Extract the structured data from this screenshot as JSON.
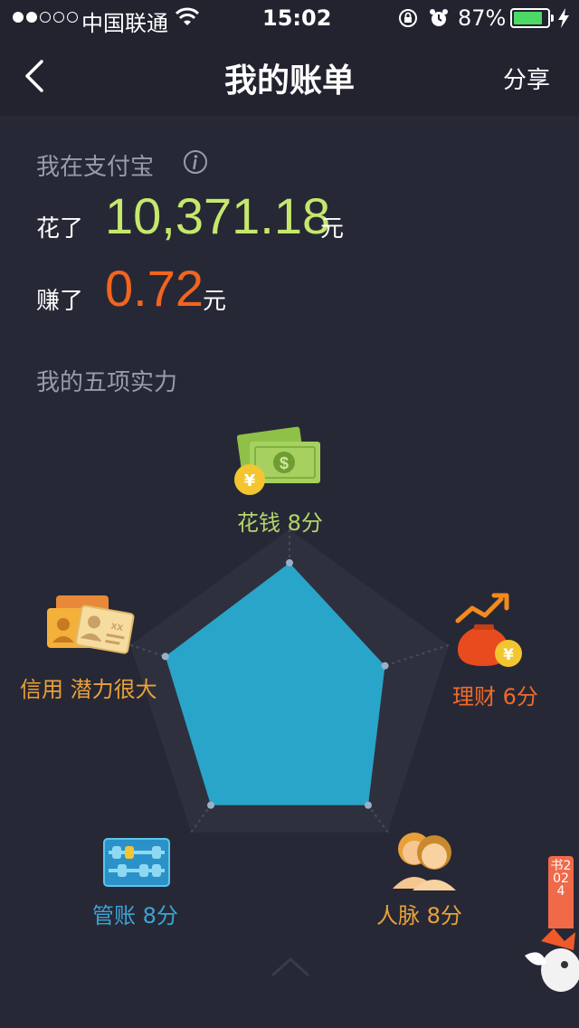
{
  "status_bar": {
    "carrier": "中国联通",
    "time": "15:02",
    "battery_text": "87%",
    "battery_level": 0.87
  },
  "nav": {
    "title": "我的账单",
    "share_label": "分享"
  },
  "summary": {
    "heading": "我在支付宝",
    "spent_prefix": "花了",
    "spent_amount": "10,371.18",
    "spent_unit": "元",
    "earned_prefix": "赚了",
    "earned_amount": "0.72",
    "earned_unit": "元"
  },
  "abilities": {
    "heading": "我的五项实力",
    "axes": [
      {
        "label": "花钱 8分",
        "score": 8,
        "color": "#b4d56a",
        "icon": "money-icon"
      },
      {
        "label": "理财 6分",
        "score": 6,
        "color": "#f06a2a",
        "icon": "moneybag-icon"
      },
      {
        "label": "人脉 8分",
        "score": 8,
        "color": "#e8a13a",
        "icon": "people-icon"
      },
      {
        "label": "管账 8分",
        "score": 8,
        "color": "#3aa5d6",
        "icon": "abacus-icon"
      },
      {
        "label": "信用 潜力很大",
        "score": 7.8,
        "color": "#e8a13a",
        "icon": "id-card-icon"
      }
    ],
    "max_score": 10
  },
  "colors": {
    "background": "#272836",
    "bar": "#22232f",
    "spent": "#c5e86c",
    "earned": "#f3641e",
    "radar_fill": "#29a5c9"
  },
  "banner_tag": "书2024"
}
